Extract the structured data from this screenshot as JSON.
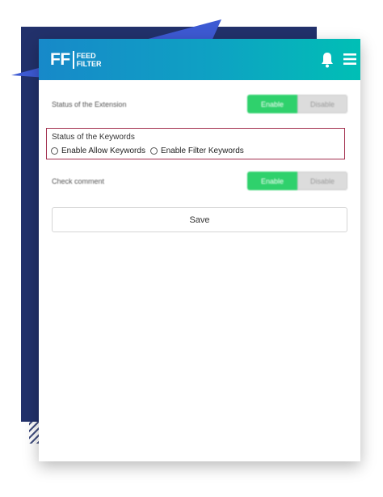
{
  "app": {
    "logo_mark": "FF",
    "logo_line1": "FEED",
    "logo_line2": "FILTER"
  },
  "colors": {
    "header_gradient_start": "#1789c9",
    "header_gradient_end": "#00bfb5",
    "enable_green": "#2fd16c",
    "backdrop_navy": "#22316b",
    "accent_blue": "#3d5ad3",
    "highlight_border": "#a3304f"
  },
  "header_icons": [
    "bell-icon",
    "hamburger-menu-icon"
  ],
  "settings": {
    "extension_status": {
      "label": "Status of the Extension",
      "enable_label": "Enable",
      "disable_label": "Disable",
      "selected": "Enable"
    },
    "keywords_status": {
      "label": "Status of the Keywords",
      "options": [
        "Enable Allow Keywords",
        "Enable Filter Keywords"
      ],
      "selected": null
    },
    "check_comment": {
      "label": "Check comment",
      "enable_label": "Enable",
      "disable_label": "Disable",
      "selected": "Enable"
    }
  },
  "actions": {
    "save_label": "Save"
  }
}
